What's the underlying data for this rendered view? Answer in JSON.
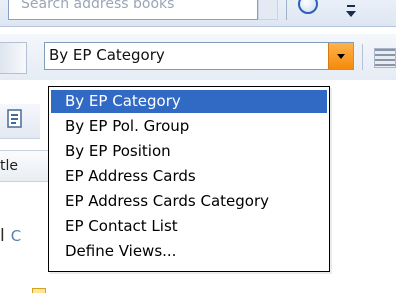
{
  "top": {
    "search_placeholder": "Search address books"
  },
  "view_selector": {
    "value": "By EP Category",
    "options": [
      {
        "label": "By EP Category",
        "selected": true
      },
      {
        "label": "By EP Pol. Group",
        "selected": false
      },
      {
        "label": "By EP Position",
        "selected": false
      },
      {
        "label": "EP Address Cards",
        "selected": false
      },
      {
        "label": "EP Address Cards Category",
        "selected": false
      },
      {
        "label": "EP Contact List",
        "selected": false
      },
      {
        "label": "Define Views...",
        "selected": false
      }
    ]
  },
  "background": {
    "column_header_fragment": "tle",
    "body_fragment_1": "l",
    "body_fragment_2": "C"
  },
  "colors": {
    "selection": "#316ac5",
    "combo_arrow": "#f58a0b",
    "dropdown_border": "#000000"
  }
}
